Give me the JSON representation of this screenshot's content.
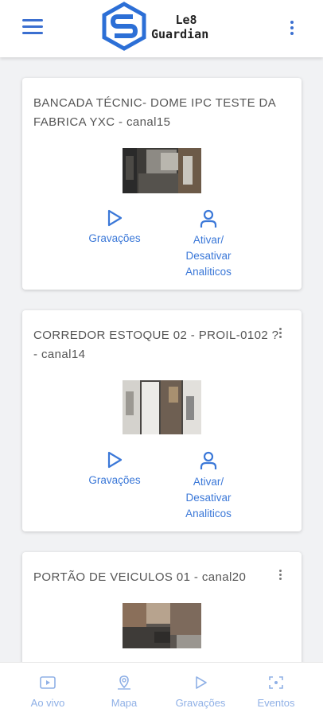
{
  "app": {
    "logo_line1": "Le8",
    "logo_line2": "Guardian"
  },
  "colors": {
    "accent": "#3b6fd0",
    "action": "#3b78d8",
    "nav_inactive": "#8fb0e6"
  },
  "cameras": [
    {
      "title": "BANCADA TÉCNIC- DOME IPC TESTE DA FABRICA YXC - canal15",
      "recordings_label": "Gravações",
      "analytics_label": "Ativar/ Desativar Analiticos"
    },
    {
      "title": "CORREDOR ESTOQUE 02 - PROIL-0102 ? - canal14",
      "recordings_label": "Gravações",
      "analytics_label": "Ativar/ Desativar Analiticos"
    },
    {
      "title": "PORTÃO DE VEICULOS 01 - canal20"
    }
  ],
  "bottom_nav": {
    "live": "Ao vivo",
    "map": "Mapa",
    "recordings": "Gravações",
    "events": "Eventos"
  },
  "icons": {
    "menu": "hamburger-icon",
    "more": "more-vert-icon",
    "play": "play-icon",
    "person": "person-icon",
    "live": "video-icon",
    "map": "map-pin-icon",
    "events": "events-icon"
  }
}
